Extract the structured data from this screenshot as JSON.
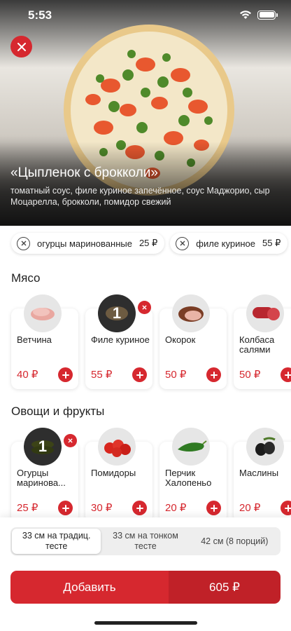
{
  "status_bar": {
    "time": "5:53"
  },
  "product": {
    "title": "«Цыпленок с брокколи»",
    "description": "томатный соус, филе куриное запечённое, соус Маджорио, сыр Моцарелла, брокколи, помидор свежий"
  },
  "removed_ingredients": [
    {
      "name": "огурцы маринованные",
      "price": "25 ₽"
    },
    {
      "name": "филе куриное",
      "price": "55 ₽"
    }
  ],
  "sections": [
    {
      "title": "Мясо",
      "items": [
        {
          "name": "Ветчина",
          "price": "40 ₽",
          "qty": null,
          "icon": "ham-icon"
        },
        {
          "name": "Филе куриное",
          "price": "55 ₽",
          "qty": "1",
          "icon": "chicken-fillet-icon"
        },
        {
          "name": "Окорок",
          "price": "50 ₽",
          "qty": null,
          "icon": "gammon-icon"
        },
        {
          "name": "Колбаса салями",
          "price": "50 ₽",
          "qty": null,
          "icon": "salami-icon"
        }
      ]
    },
    {
      "title": "Овощи и фрукты",
      "items": [
        {
          "name": "Огурцы маринова...",
          "price": "25 ₽",
          "qty": "1",
          "icon": "pickles-icon"
        },
        {
          "name": "Помидоры",
          "price": "30 ₽",
          "qty": null,
          "icon": "tomatoes-icon"
        },
        {
          "name": "Перчик Халопеньо",
          "price": "20 ₽",
          "qty": null,
          "icon": "jalapeno-icon"
        },
        {
          "name": "Маслины",
          "price": "20 ₽",
          "qty": null,
          "icon": "olives-icon"
        }
      ]
    }
  ],
  "sizes": [
    {
      "label": "33 см на традиц. тесте",
      "active": true
    },
    {
      "label": "33 см на тонком тесте",
      "active": false
    },
    {
      "label": "42 см (8 порций)",
      "active": false
    }
  ],
  "add_button": {
    "label": "Добавить",
    "total": "605 ₽"
  },
  "colors": {
    "accent": "#d6282f",
    "accent_dark": "#c02128"
  }
}
